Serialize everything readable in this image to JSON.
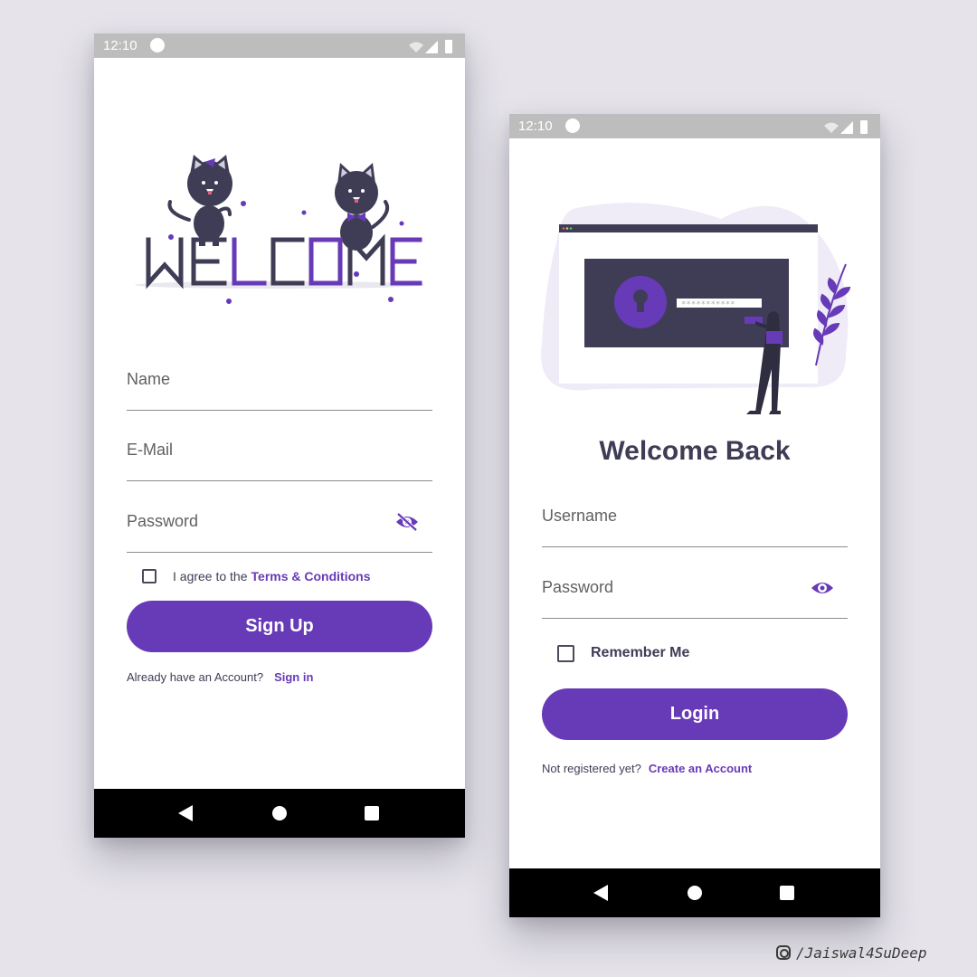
{
  "signup": {
    "status_time": "12:10",
    "fields": {
      "name_label": "Name",
      "email_label": "E-Mail",
      "password_label": "Password"
    },
    "terms": {
      "prefix": "I agree to the",
      "link": "Terms & Conditions"
    },
    "button_label": "Sign Up",
    "footer": {
      "text": "Already have an Account?",
      "link": "Sign in"
    },
    "password_icon": "eye-off-icon"
  },
  "login": {
    "status_time": "12:10",
    "title": "Welcome Back",
    "fields": {
      "username_label": "Username",
      "password_label": "Password"
    },
    "remember_label": "Remember Me",
    "button_label": "Login",
    "footer": {
      "text": "Not registered yet?",
      "link": "Create an Account"
    },
    "password_icon": "eye-icon"
  },
  "watermark": "/Jaiswal4SuDeep",
  "colors": {
    "accent": "#673ab7",
    "dark": "#3f3d56",
    "light_purple": "#efebf7"
  }
}
